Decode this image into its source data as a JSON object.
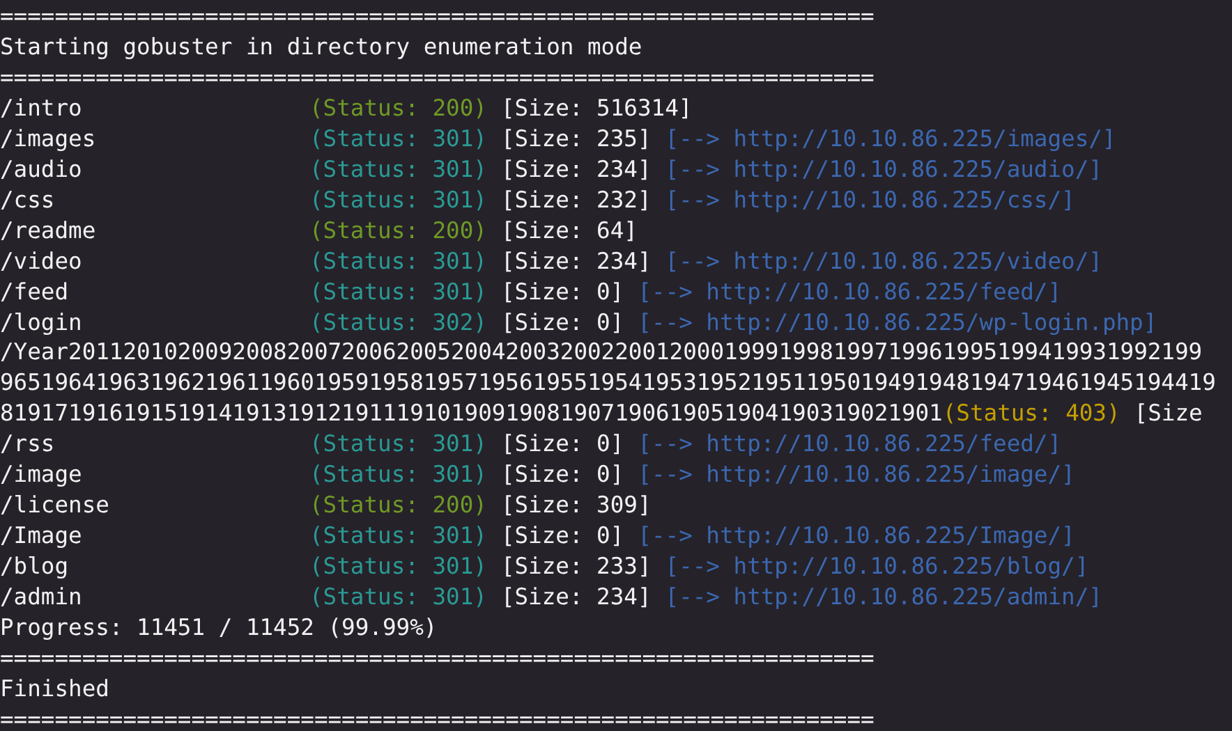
{
  "lines": [
    {
      "kind": "plain",
      "text": "================================================================"
    },
    {
      "kind": "plain",
      "text": "Starting gobuster in directory enumeration mode"
    },
    {
      "kind": "plain",
      "text": "================================================================"
    },
    {
      "kind": "result",
      "path": "/intro",
      "status": "(Status: 200)",
      "color": "#6e9a26",
      "size": "[Size: 516314]"
    },
    {
      "kind": "result",
      "path": "/images",
      "status": "(Status: 301)",
      "color": "#2a9a94",
      "size": "[Size: 235]",
      "redirect": "[--> http://10.10.86.225/images/]"
    },
    {
      "kind": "result",
      "path": "/audio",
      "status": "(Status: 301)",
      "color": "#2a9a94",
      "size": "[Size: 234]",
      "redirect": "[--> http://10.10.86.225/audio/]"
    },
    {
      "kind": "result",
      "path": "/css",
      "status": "(Status: 301)",
      "color": "#2a9a94",
      "size": "[Size: 232]",
      "redirect": "[--> http://10.10.86.225/css/]"
    },
    {
      "kind": "result",
      "path": "/readme",
      "status": "(Status: 200)",
      "color": "#6e9a26",
      "size": "[Size: 64]"
    },
    {
      "kind": "result",
      "path": "/video",
      "status": "(Status: 301)",
      "color": "#2a9a94",
      "size": "[Size: 234]",
      "redirect": "[--> http://10.10.86.225/video/]"
    },
    {
      "kind": "result",
      "path": "/feed",
      "status": "(Status: 301)",
      "color": "#2a9a94",
      "size": "[Size: 0]",
      "redirect": "[--> http://10.10.86.225/feed/]"
    },
    {
      "kind": "result",
      "path": "/login",
      "status": "(Status: 302)",
      "color": "#2a9a94",
      "size": "[Size: 0]",
      "redirect": "[--> http://10.10.86.225/wp-login.php]"
    },
    {
      "kind": "plain",
      "text": "/Year20112010200920082007200620052004200320022001200019991998199719961995199419931992199"
    },
    {
      "kind": "plain",
      "text": "96519641963196219611960195919581957195619551954195319521951195019491948194719461945194419"
    },
    {
      "kind": "result",
      "path": "819171916191519141913191219111910190919081907190619051904190319021901",
      "status": "(Status: 403)",
      "color": "#c4a000",
      "size": "[Size"
    },
    {
      "kind": "result",
      "path": "/rss",
      "status": "(Status: 301)",
      "color": "#2a9a94",
      "size": "[Size: 0]",
      "redirect": "[--> http://10.10.86.225/feed/]"
    },
    {
      "kind": "result",
      "path": "/image",
      "status": "(Status: 301)",
      "color": "#2a9a94",
      "size": "[Size: 0]",
      "redirect": "[--> http://10.10.86.225/image/]"
    },
    {
      "kind": "result",
      "path": "/license",
      "status": "(Status: 200)",
      "color": "#6e9a26",
      "size": "[Size: 309]"
    },
    {
      "kind": "result",
      "path": "/Image",
      "status": "(Status: 301)",
      "color": "#2a9a94",
      "size": "[Size: 0]",
      "redirect": "[--> http://10.10.86.225/Image/]"
    },
    {
      "kind": "result",
      "path": "/blog",
      "status": "(Status: 301)",
      "color": "#2a9a94",
      "size": "[Size: 233]",
      "redirect": "[--> http://10.10.86.225/blog/]"
    },
    {
      "kind": "result",
      "path": "/admin",
      "status": "(Status: 301)",
      "color": "#2a9a94",
      "size": "[Size: 234]",
      "redirect": "[--> http://10.10.86.225/admin/]"
    },
    {
      "kind": "plain",
      "text": "Progress: 11451 / 11452 (99.99%)"
    },
    {
      "kind": "plain",
      "text": "================================================================"
    },
    {
      "kind": "plain",
      "text": "Finished"
    },
    {
      "kind": "plain",
      "text": "================================================================"
    }
  ]
}
